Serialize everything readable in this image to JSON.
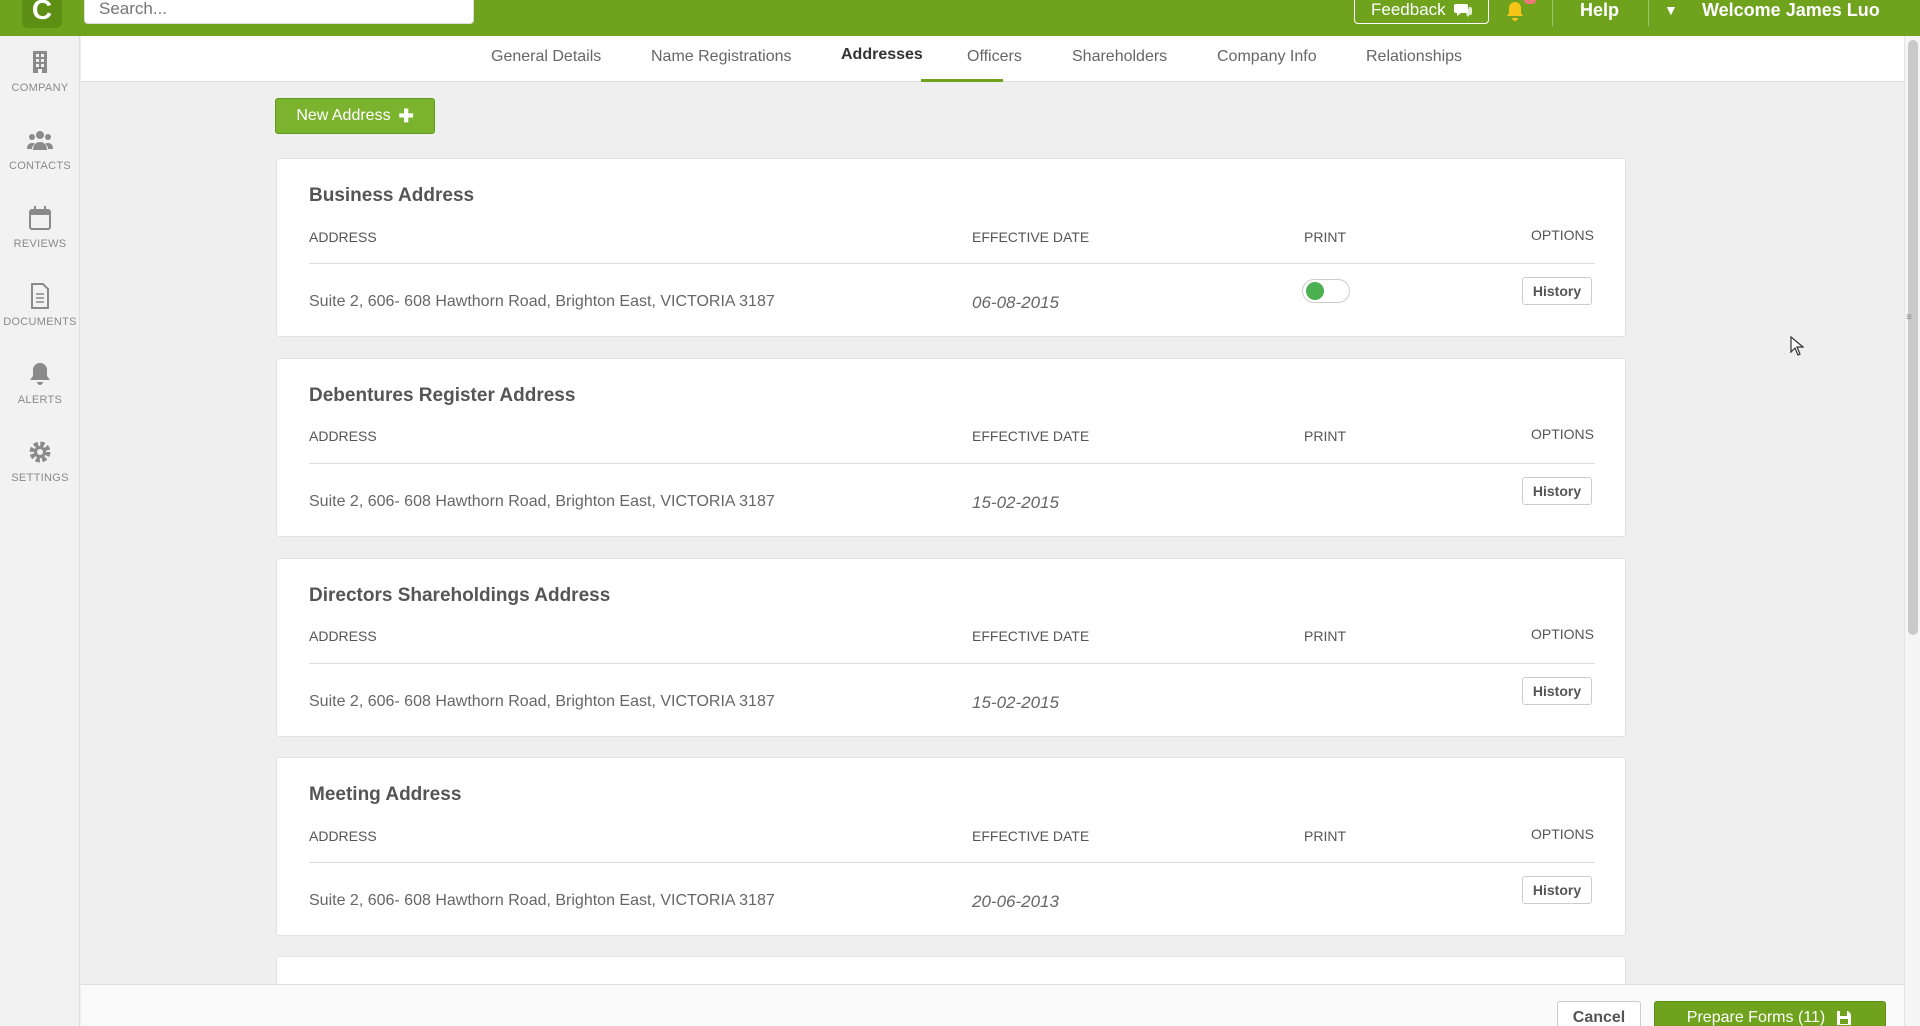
{
  "topbar": {
    "logo": "C",
    "search_placeholder": "Search...",
    "feedback_label": "Feedback",
    "help_label": "Help",
    "welcome": "Welcome James Luo",
    "accent_color": "#6fa31d"
  },
  "sidebar": {
    "items": [
      {
        "label": "COMPANY",
        "icon": "building-icon"
      },
      {
        "label": "CONTACTS",
        "icon": "people-icon"
      },
      {
        "label": "REVIEWS",
        "icon": "calendar-icon"
      },
      {
        "label": "DOCUMENTS",
        "icon": "document-icon"
      },
      {
        "label": "ALERTS",
        "icon": "bell-icon"
      },
      {
        "label": "SETTINGS",
        "icon": "gear-icon"
      }
    ]
  },
  "tabs": [
    {
      "label": "General Details"
    },
    {
      "label": "Name Registrations"
    },
    {
      "label": "Addresses",
      "active": true
    },
    {
      "label": "Officers"
    },
    {
      "label": "Shareholders"
    },
    {
      "label": "Company Info"
    },
    {
      "label": "Relationships"
    }
  ],
  "new_address_label": "New Address",
  "columns": {
    "address": "ADDRESS",
    "effective_date": "EFFECTIVE DATE",
    "print": "PRINT",
    "options": "OPTIONS"
  },
  "history_label": "History",
  "cards": [
    {
      "title": "Business Address",
      "address": "Suite 2, 606- 608 Hawthorn Road, Brighton East, VICTORIA 3187",
      "date": "06-08-2015",
      "print_toggle": true
    },
    {
      "title": "Debentures Register Address",
      "address": "Suite 2, 606- 608 Hawthorn Road, Brighton East, VICTORIA 3187",
      "date": "15-02-2015",
      "print_toggle": false
    },
    {
      "title": "Directors Shareholdings Address",
      "address": "Suite 2, 606- 608 Hawthorn Road, Brighton East, VICTORIA 3187",
      "date": "15-02-2015",
      "print_toggle": false
    },
    {
      "title": "Meeting Address",
      "address": "Suite 2, 606- 608 Hawthorn Road, Brighton East, VICTORIA 3187",
      "date": "20-06-2013",
      "print_toggle": false
    }
  ],
  "footer": {
    "cancel_label": "Cancel",
    "prepare_label": "Prepare Forms (11)"
  }
}
